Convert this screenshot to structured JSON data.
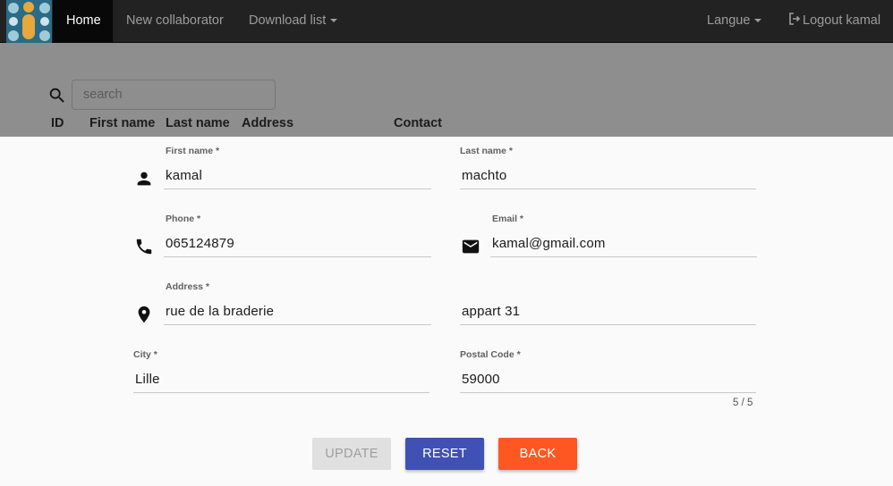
{
  "navbar": {
    "home": "Home",
    "new_collaborator": "New collaborator",
    "download_list": "Download list",
    "langue": "Langue",
    "logout": "Logout kamal"
  },
  "search": {
    "placeholder": "search"
  },
  "table_headers": [
    "ID",
    "First name",
    "Last name",
    "Address",
    "Contact"
  ],
  "form": {
    "first_name": {
      "label": "First name *",
      "value": "kamal"
    },
    "last_name": {
      "label": "Last name *",
      "value": "machto"
    },
    "phone": {
      "label": "Phone *",
      "value": "065124879"
    },
    "email": {
      "label": "Email *",
      "value": "kamal@gmail.com"
    },
    "address": {
      "label": "Address *",
      "value": "rue de la braderie"
    },
    "address2": {
      "value": "appart 31"
    },
    "city": {
      "label": "City *",
      "value": "Lille"
    },
    "postal_code": {
      "label": "Postal Code *",
      "value": "59000",
      "counter": "5 / 5"
    }
  },
  "buttons": {
    "update": "UPDATE",
    "reset": "RESET",
    "back": "BACK"
  },
  "colors": {
    "navbar": "#222222",
    "reset": "#3f51b5",
    "back": "#ff5722",
    "disabled": "#e0e0e0"
  }
}
